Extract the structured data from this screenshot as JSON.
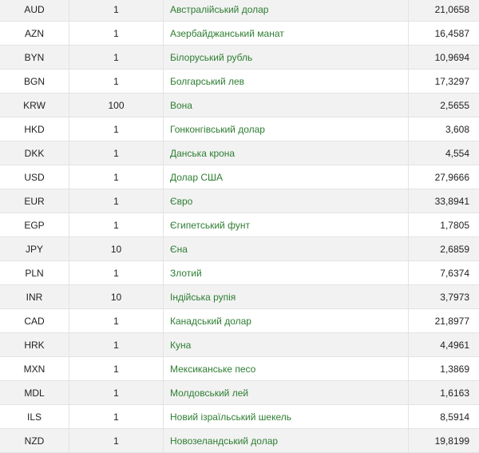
{
  "colors": {
    "name_link": "#2e7d32",
    "row_alt": "#f2f2f2",
    "border": "#e3e3e3"
  },
  "rows": [
    {
      "code": "AUD",
      "units": "1",
      "name": "Австралійський долар",
      "rate": "21,0658"
    },
    {
      "code": "AZN",
      "units": "1",
      "name": "Азербайджанський манат",
      "rate": "16,4587"
    },
    {
      "code": "BYN",
      "units": "1",
      "name": "Білоруський рубль",
      "rate": "10,9694"
    },
    {
      "code": "BGN",
      "units": "1",
      "name": "Болгарський лев",
      "rate": "17,3297"
    },
    {
      "code": "KRW",
      "units": "100",
      "name": "Вона",
      "rate": "2,5655"
    },
    {
      "code": "HKD",
      "units": "1",
      "name": "Гонконгівський долар",
      "rate": "3,608"
    },
    {
      "code": "DKK",
      "units": "1",
      "name": "Данська крона",
      "rate": "4,554"
    },
    {
      "code": "USD",
      "units": "1",
      "name": "Долар США",
      "rate": "27,9666"
    },
    {
      "code": "EUR",
      "units": "1",
      "name": "Євро",
      "rate": "33,8941"
    },
    {
      "code": "EGP",
      "units": "1",
      "name": "Єгипетський фунт",
      "rate": "1,7805"
    },
    {
      "code": "JPY",
      "units": "10",
      "name": "Єна",
      "rate": "2,6859"
    },
    {
      "code": "PLN",
      "units": "1",
      "name": "Злотий",
      "rate": "7,6374"
    },
    {
      "code": "INR",
      "units": "10",
      "name": "Індійська рупія",
      "rate": "3,7973"
    },
    {
      "code": "CAD",
      "units": "1",
      "name": "Канадський долар",
      "rate": "21,8977"
    },
    {
      "code": "HRK",
      "units": "1",
      "name": "Куна",
      "rate": "4,4961"
    },
    {
      "code": "MXN",
      "units": "1",
      "name": "Мексиканське песо",
      "rate": "1,3869"
    },
    {
      "code": "MDL",
      "units": "1",
      "name": "Молдовський лей",
      "rate": "1,6163"
    },
    {
      "code": "ILS",
      "units": "1",
      "name": "Новий ізраїльський шекель",
      "rate": "8,5914"
    },
    {
      "code": "NZD",
      "units": "1",
      "name": "Новозеландський долар",
      "rate": "19,8199"
    }
  ]
}
